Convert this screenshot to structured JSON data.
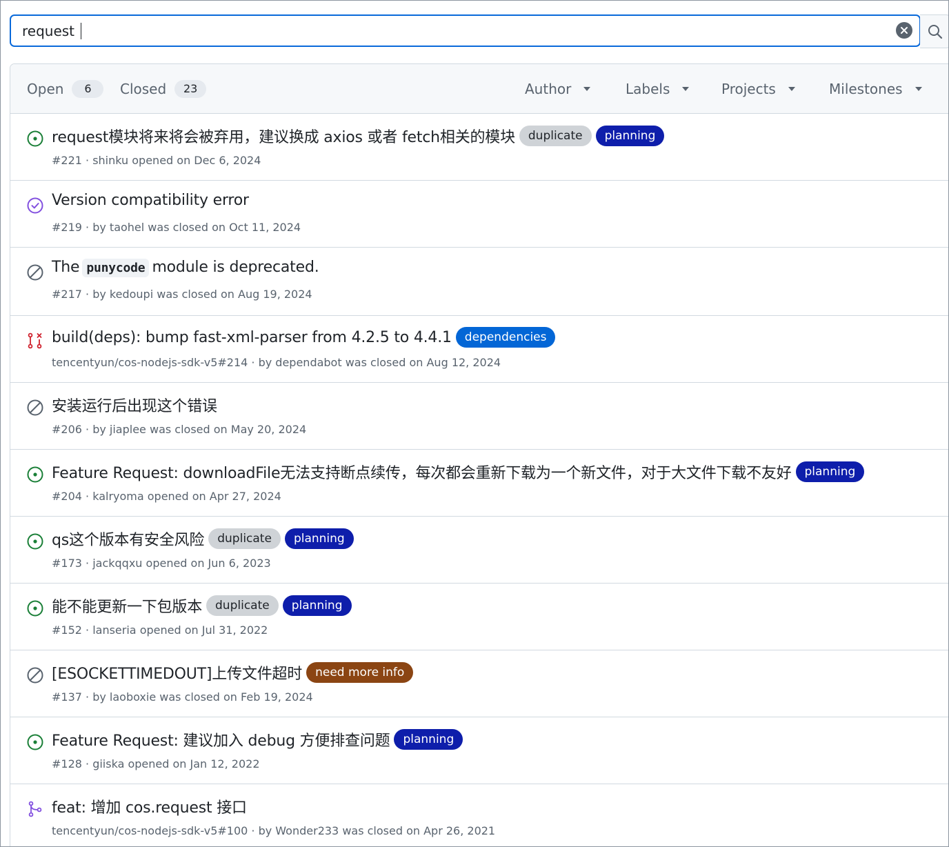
{
  "search": {
    "value": "request",
    "clear_label": "✕",
    "search_label": "⌕"
  },
  "header": {
    "open_label": "Open",
    "open_count": "6",
    "closed_label": "Closed",
    "closed_count": "23",
    "filters": [
      "Author",
      "Labels",
      "Projects",
      "Milestones"
    ]
  },
  "colors": {
    "open": "#1a7f37",
    "closed_done": "#8250df",
    "not_planned": "#59636e",
    "pr_closed": "#cf222e",
    "pr_merged": "#8250df",
    "label_duplicate_bg": "#cfd3d7",
    "label_planning_bg": "#0e1eab",
    "label_dependencies_bg": "#0366d6",
    "label_needinfo_bg": "#8b4513"
  },
  "issues": [
    {
      "state": "open",
      "icon": "issue-open-icon",
      "title": "request模块将来将会被弃用，建议换成 axios 或者 fetch相关的模块",
      "meta": "#221 · shinku opened on Dec 6, 2024",
      "labels": [
        {
          "name": "duplicate",
          "bg": "#cfd3d7",
          "fg": "#1f2328"
        },
        {
          "name": "planning",
          "bg": "#0e1eab",
          "fg": "#ffffff"
        }
      ]
    },
    {
      "state": "closed-completed",
      "icon": "issue-closed-icon",
      "title": "Version compatibility error",
      "meta": "#219 · by taohel was closed on Oct 11, 2024",
      "labels": []
    },
    {
      "state": "closed-not-planned",
      "icon": "issue-not-planned-icon",
      "title_parts": [
        "The",
        "punycode",
        "module is deprecated."
      ],
      "meta": "#217 · by kedoupi was closed on Aug 19, 2024",
      "labels": []
    },
    {
      "state": "pr-closed",
      "icon": "pull-request-closed-icon",
      "title": "build(deps): bump fast-xml-parser from 4.2.5 to 4.4.1",
      "meta": "tencentyun/cos-nodejs-sdk-v5#214 · by dependabot was closed on Aug 12, 2024",
      "labels": [
        {
          "name": "dependencies",
          "bg": "#0366d6",
          "fg": "#ffffff"
        }
      ]
    },
    {
      "state": "closed-not-planned",
      "icon": "issue-not-planned-icon",
      "title": "安装运行后出现这个错误",
      "meta": "#206 · by jiaplee was closed on May 20, 2024",
      "labels": []
    },
    {
      "state": "open",
      "icon": "issue-open-icon",
      "title": "Feature Request: downloadFile无法支持断点续传，每次都会重新下载为一个新文件，对于大文件下载不友好",
      "meta": "#204 · kalryoma opened on Apr 27, 2024",
      "labels": [
        {
          "name": "planning",
          "bg": "#0e1eab",
          "fg": "#ffffff"
        }
      ]
    },
    {
      "state": "open",
      "icon": "issue-open-icon",
      "title": "qs这个版本有安全风险",
      "meta": "#173 · jackqqxu opened on Jun 6, 2023",
      "labels": [
        {
          "name": "duplicate",
          "bg": "#cfd3d7",
          "fg": "#1f2328"
        },
        {
          "name": "planning",
          "bg": "#0e1eab",
          "fg": "#ffffff"
        }
      ]
    },
    {
      "state": "open",
      "icon": "issue-open-icon",
      "title": "能不能更新一下包版本",
      "meta": "#152 · lanseria opened on Jul 31, 2022",
      "labels": [
        {
          "name": "duplicate",
          "bg": "#cfd3d7",
          "fg": "#1f2328"
        },
        {
          "name": "planning",
          "bg": "#0e1eab",
          "fg": "#ffffff"
        }
      ]
    },
    {
      "state": "closed-not-planned",
      "icon": "issue-not-planned-icon",
      "title": "[ESOCKETTIMEDOUT]上传文件超时",
      "meta": "#137 · by laoboxie was closed on Feb 19, 2024",
      "labels": [
        {
          "name": "need more info",
          "bg": "#8b4513",
          "fg": "#ffffff"
        }
      ]
    },
    {
      "state": "open",
      "icon": "issue-open-icon",
      "title": "Feature Request: 建议加入 debug 方便排查问题",
      "meta": "#128 · giiska opened on Jan 12, 2022",
      "labels": [
        {
          "name": "planning",
          "bg": "#0e1eab",
          "fg": "#ffffff"
        }
      ]
    },
    {
      "state": "pr-merged",
      "icon": "pull-request-merged-icon",
      "title": "feat: 增加 cos.request 接口",
      "meta": "tencentyun/cos-nodejs-sdk-v5#100 · by Wonder233 was closed on Apr 26, 2021",
      "labels": []
    }
  ]
}
